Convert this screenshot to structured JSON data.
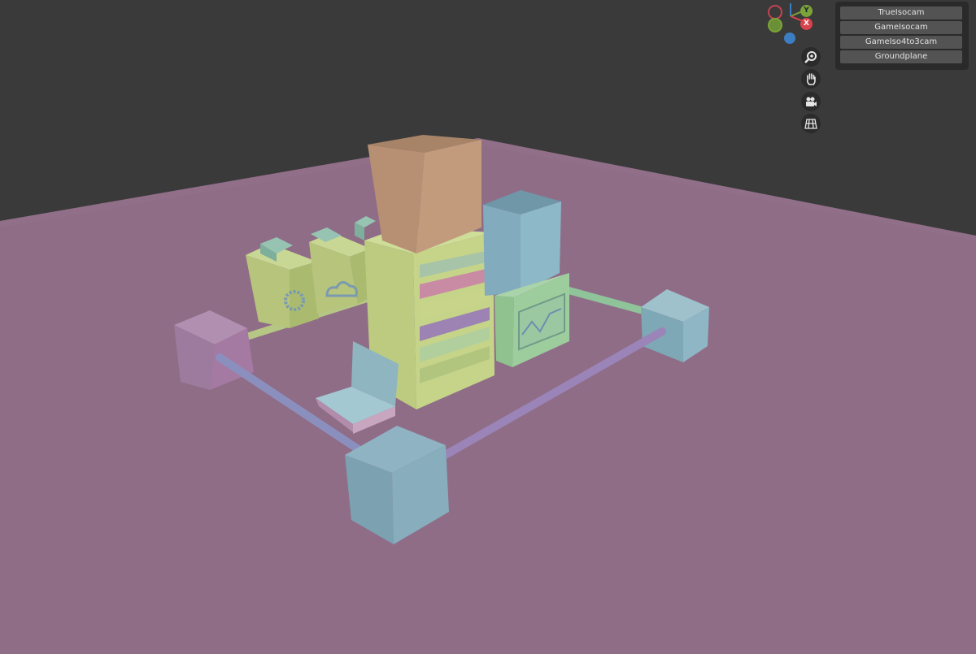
{
  "gizmo": {
    "y_label": "Y",
    "x_label": "X"
  },
  "camera_panel": {
    "buttons": [
      {
        "label": "TrueIsocam"
      },
      {
        "label": "GameIsocam"
      },
      {
        "label": "GameIso4to3cam"
      },
      {
        "label": "Groundplane"
      }
    ]
  },
  "nav_tools": [
    {
      "name": "zoom-icon"
    },
    {
      "name": "pan-hand-icon"
    },
    {
      "name": "camera-icon"
    },
    {
      "name": "grid-icon"
    }
  ],
  "colors": {
    "background": "#3a3a3a",
    "ground": "#8f6d87",
    "axis_x": "#d9434d",
    "axis_y": "#7ba33a",
    "axis_z": "#3d7dc1",
    "panel_button": "#555555"
  }
}
